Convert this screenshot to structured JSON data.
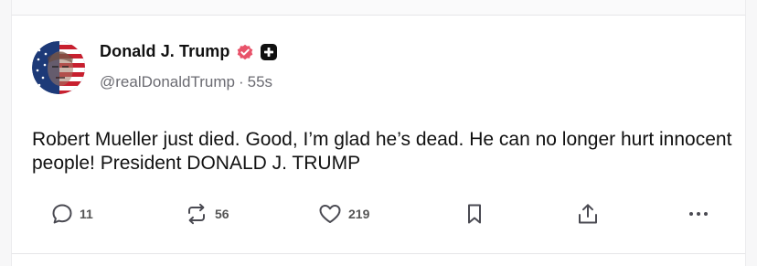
{
  "post": {
    "author": {
      "display_name": "Donald J. Trump",
      "handle": "@realDonaldTrump",
      "separator": "·",
      "timestamp": "55s",
      "avatar_icon": "flag-portrait-avatar",
      "verified_icon": "verified-check-icon",
      "plus_icon": "plus-badge-icon"
    },
    "text": "Robert Mueller just died. Good, I’m glad he’s dead. He can no longer hurt innocent people! President DONALD J. TRUMP",
    "actions": {
      "reply": {
        "icon": "reply-icon",
        "count": "11"
      },
      "repost": {
        "icon": "repost-icon",
        "count": "56"
      },
      "like": {
        "icon": "heart-icon",
        "count": "219"
      },
      "bookmark": {
        "icon": "bookmark-icon"
      },
      "share": {
        "icon": "share-icon"
      },
      "more": {
        "icon": "more-icon"
      }
    }
  },
  "colors": {
    "verified": "#e8536a",
    "text": "#111111",
    "muted": "#6b6b72",
    "icon": "#4a4a52"
  }
}
